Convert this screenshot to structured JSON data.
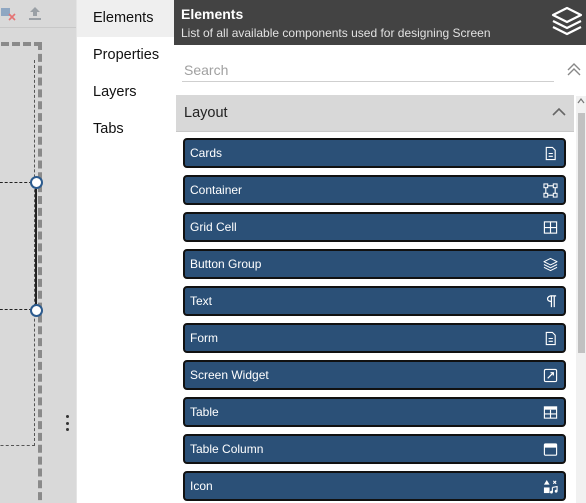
{
  "nav": {
    "items": [
      {
        "label": "Elements",
        "active": true
      },
      {
        "label": "Properties",
        "active": false
      },
      {
        "label": "Layers",
        "active": false
      },
      {
        "label": "Tabs",
        "active": false
      }
    ]
  },
  "panel": {
    "title": "Elements",
    "subtitle": "List of all available components used for designing Screen",
    "header_icon": "layers-stack-icon"
  },
  "search": {
    "placeholder": "Search",
    "value": ""
  },
  "section": {
    "label": "Layout",
    "expanded": true
  },
  "elements": [
    {
      "label": "Cards",
      "icon": "document-icon"
    },
    {
      "label": "Container",
      "icon": "frame-icon"
    },
    {
      "label": "Grid Cell",
      "icon": "grid-icon"
    },
    {
      "label": "Button Group",
      "icon": "layers-icon"
    },
    {
      "label": "Text",
      "icon": "pilcrow-icon"
    },
    {
      "label": "Form",
      "icon": "document-icon"
    },
    {
      "label": "Screen Widget",
      "icon": "widget-icon"
    },
    {
      "label": "Table",
      "icon": "table-icon"
    },
    {
      "label": "Table Column",
      "icon": "table-column-icon"
    },
    {
      "label": "Icon",
      "icon": "icon-shapes-icon"
    }
  ],
  "colors": {
    "header_bg": "#434343",
    "item_bg": "#2b5077",
    "handle_border": "#2c5b8e",
    "section_bg": "#d8d8d8"
  }
}
